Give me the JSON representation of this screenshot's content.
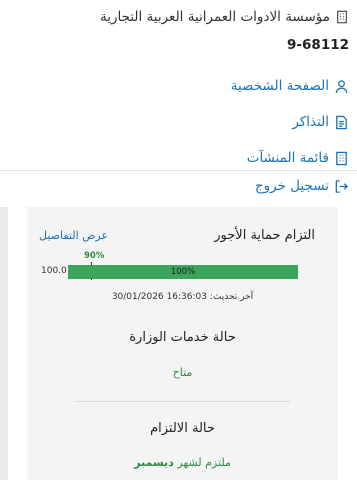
{
  "header": {
    "org_name": "مؤسسة الادوات العمرانية العربية التجارية",
    "org_id": "9-68112"
  },
  "menu": {
    "items": [
      {
        "label": "الصفحة الشخصية",
        "icon": "user-icon"
      },
      {
        "label": "التذاكر",
        "icon": "ticket-icon"
      },
      {
        "label": "قائمة المنشآت",
        "icon": "building-icon"
      }
    ],
    "logout_label": "تسجيل خروج"
  },
  "wage_protection": {
    "title": "التزام حماية الأجور",
    "details_link": "عرض التفاصيل",
    "target_label": "90%",
    "bar_max_label": "100.0",
    "bar_value_label": "100%",
    "bar_value": 100,
    "target_value": 90,
    "updated_label": "آخر تحديث:",
    "updated_value": "16:36:03 30/01/2026"
  },
  "ministry_services": {
    "title": "حالة خدمات الوزارة",
    "value": "متاح"
  },
  "compliance": {
    "title": "حالة الالتزام",
    "value_prefix": "ملتزم لشهر",
    "value_month": "ديسمبر"
  },
  "colors": {
    "link": "#1a73b8",
    "success": "#3ca55c",
    "status_text": "#2e8b3e"
  }
}
